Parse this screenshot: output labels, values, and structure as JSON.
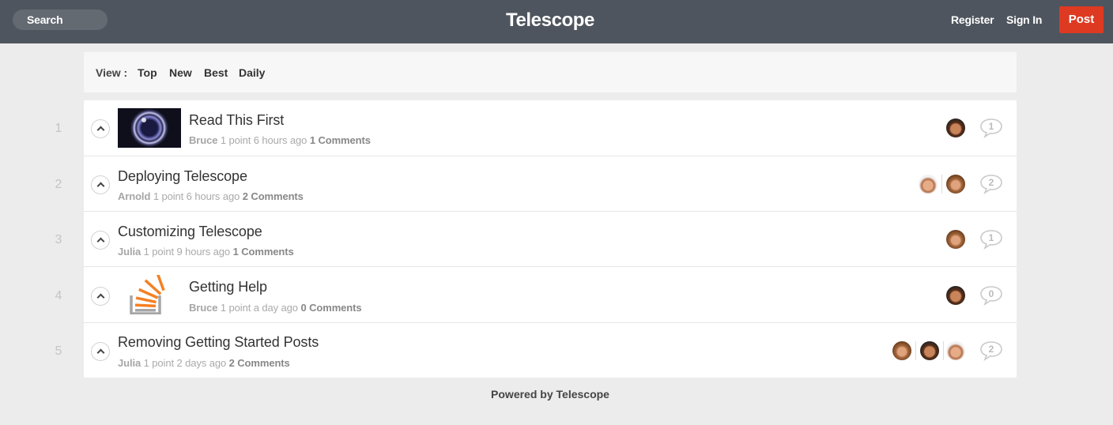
{
  "header": {
    "search_label": "Search",
    "logo": "Telescope",
    "register": "Register",
    "sign_in": "Sign In",
    "post": "Post",
    "accent_color": "#de3a22",
    "bar_color": "#4f555e"
  },
  "view": {
    "label": "View :",
    "options": [
      "Top",
      "New",
      "Best",
      "Daily"
    ]
  },
  "posts": [
    {
      "rank": "1",
      "title": "Read This First",
      "author": "Bruce",
      "points": "1 point",
      "time": "6 hours ago",
      "comments": "1 Comments",
      "comment_count": "1",
      "thumbnail": "camera-lens",
      "avatars": [
        "bruce"
      ]
    },
    {
      "rank": "2",
      "title": "Deploying Telescope",
      "author": "Arnold",
      "points": "1 point",
      "time": "6 hours ago",
      "comments": "2 Comments",
      "comment_count": "2",
      "thumbnail": null,
      "avatars": [
        "arnold",
        "julia"
      ]
    },
    {
      "rank": "3",
      "title": "Customizing Telescope",
      "author": "Julia",
      "points": "1 point",
      "time": "9 hours ago",
      "comments": "1 Comments",
      "comment_count": "1",
      "thumbnail": null,
      "avatars": [
        "julia"
      ]
    },
    {
      "rank": "4",
      "title": "Getting Help",
      "author": "Bruce",
      "points": "1 point",
      "time": "a day ago",
      "comments": "0 Comments",
      "comment_count": "0",
      "thumbnail": "stackoverflow-logo",
      "avatars": [
        "bruce"
      ]
    },
    {
      "rank": "5",
      "title": "Removing Getting Started Posts",
      "author": "Julia",
      "points": "1 point",
      "time": "2 days ago",
      "comments": "2 Comments",
      "comment_count": "2",
      "thumbnail": null,
      "avatars": [
        "julia",
        "bruce",
        "arnold"
      ]
    }
  ],
  "footer": "Powered by Telescope"
}
